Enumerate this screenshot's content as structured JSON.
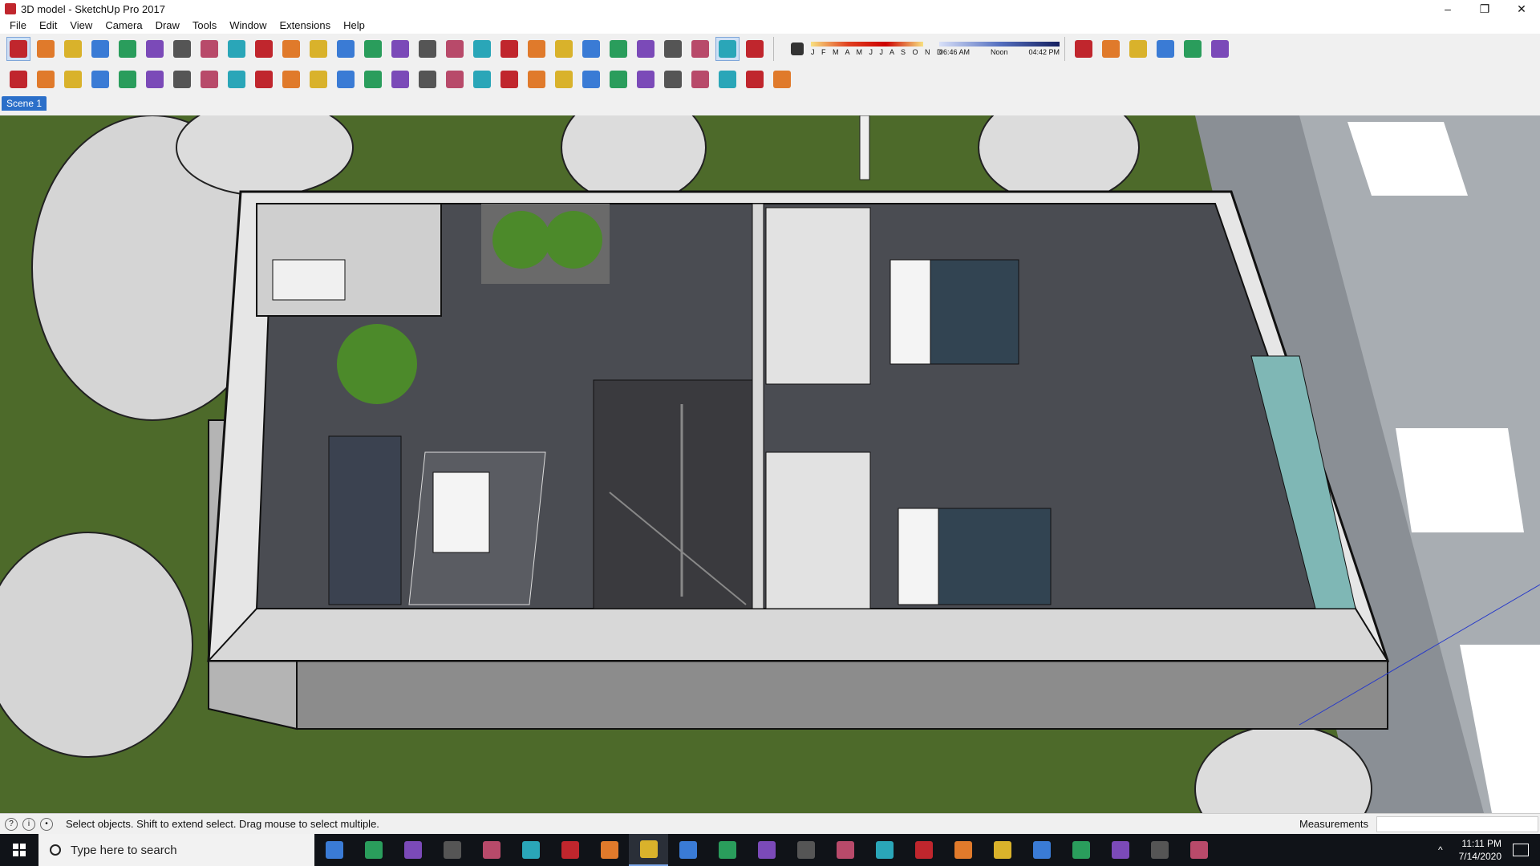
{
  "window": {
    "title": "3D model - SketchUp Pro 2017",
    "minimize": "–",
    "restore": "❐",
    "close": "✕"
  },
  "menu": [
    "File",
    "Edit",
    "View",
    "Camera",
    "Draw",
    "Tools",
    "Window",
    "Extensions",
    "Help"
  ],
  "toolbar1": {
    "tools": [
      "select-tool",
      "eraser-tool",
      "line-tool",
      "arc-tool",
      "rectangle-tool",
      "push-pull-tool",
      "follow-me-tool",
      "move-tool",
      "rotate-tool",
      "scale-tool",
      "tape-measure-tool",
      "text-tool",
      "paint-bucket-tool",
      "orbit-tool",
      "pan-tool",
      "zoom-tool",
      "zoom-extents-tool",
      "warehouse-tool",
      "share-model-tool",
      "extension-warehouse-tool",
      "layout-tool",
      "components-tool",
      "groups-tool",
      "styles-tool",
      "section-tool",
      "position-camera-tool",
      "walk-tool",
      "look-around-tool"
    ],
    "active": [
      "select-tool",
      "walk-tool"
    ],
    "shadows": {
      "months": "J F M A M J J A S O N D",
      "time_start": "06:46 AM",
      "time_mid": "Noon",
      "time_end": "04:42 PM"
    },
    "views": [
      "iso-view",
      "top-view",
      "front-view",
      "right-view",
      "back-view",
      "left-view"
    ]
  },
  "toolbar2": {
    "tools": [
      "sandbox-tool",
      "refresh-tool",
      "vehicle-tool",
      "camera-tool",
      "printer-tool",
      "shield-tool",
      "tree-tool",
      "target-tool",
      "speaker-tool",
      "settings-tool",
      "comment-tool",
      "info-tool",
      "doc-tool",
      "export-tool",
      "web-tool",
      "layout-a",
      "layout-b",
      "layout-c",
      "layout-d",
      "layout-e",
      "layout-f",
      "globe-tool",
      "material-a",
      "material-b",
      "material-c",
      "material-d",
      "material-e",
      "material-f",
      "material-g"
    ]
  },
  "scene_tab": "Scene 1",
  "status": {
    "message": "Select objects. Shift to extend select. Drag mouse to select multiple.",
    "measurements_label": "Measurements"
  },
  "taskbar": {
    "search_placeholder": "Type here to search",
    "time": "11:11 PM",
    "date": "7/14/2020",
    "apps": [
      "cortana",
      "task-view",
      "camera-app",
      "app-red",
      "video-app",
      "files-app",
      "acrobat",
      "red-app",
      "sketchup",
      "firefox",
      "vlc",
      "mail-m",
      "edge",
      "chrome",
      "mail",
      "photoshop",
      "nvidia",
      "camtasia",
      "store",
      "explorer",
      "premiere",
      "media",
      "sketchup-2"
    ]
  },
  "colors": {
    "accent": "#2b6fc9",
    "grass": "#4d6a2a",
    "floor": "#4a4c52",
    "walls": "#d8d8d8"
  }
}
